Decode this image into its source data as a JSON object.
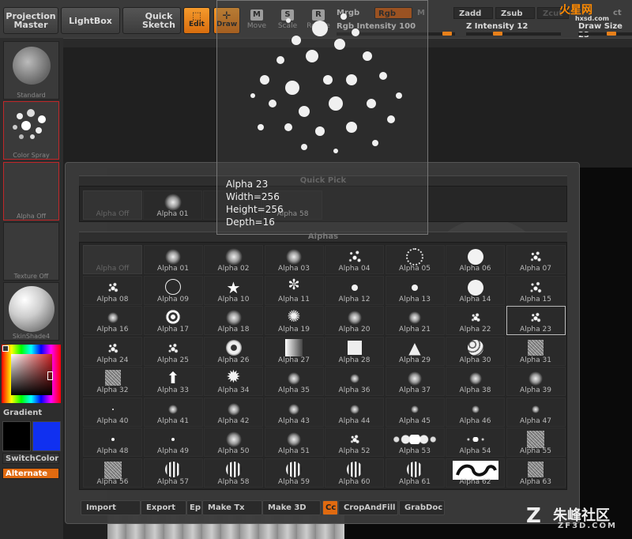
{
  "toolbar": {
    "projection_master": "Projection Master",
    "lightbox": "LightBox",
    "quick_sketch": "Quick Sketch",
    "edit": "Edit",
    "draw": "Draw",
    "move": "Move",
    "scale": "Scale",
    "rotate": "Rotate",
    "mrgb": "Mrgb",
    "rgb": "Rgb",
    "m": "M",
    "zadd": "Zadd",
    "zsub": "Zsub",
    "zcut": "Zcut",
    "rgb_intensity": "Rgb Intensity 100",
    "z_intensity": "Z Intensity 12",
    "draw_size": "Draw Size 23",
    "focal": "ct"
  },
  "left": {
    "standard": "Standard",
    "color_spray": "Color Spray",
    "alpha_off": "Alpha Off",
    "texture_off": "Texture Off",
    "skinshade": "SkinShade4",
    "gradient": "Gradient",
    "switchcolor": "SwitchColor",
    "alternate": "Alternate"
  },
  "tooltip": {
    "name": "Alpha 23",
    "width": "Width=256",
    "height": "Height=256",
    "depth": "Depth=16"
  },
  "quick_pick": {
    "title": "Quick Pick",
    "items": [
      "Alpha Off",
      "Alpha 01",
      "",
      "Alpha 58"
    ]
  },
  "alphas": {
    "title": "Alphas",
    "selected": "Alpha 23",
    "items": [
      "Alpha Off",
      "Alpha 01",
      "Alpha 02",
      "Alpha 03",
      "Alpha 04",
      "Alpha 05",
      "Alpha 06",
      "Alpha 07",
      "Alpha 08",
      "Alpha 09",
      "Alpha 10",
      "Alpha 11",
      "Alpha 12",
      "Alpha 13",
      "Alpha 14",
      "Alpha 15",
      "Alpha 16",
      "Alpha 17",
      "Alpha 18",
      "Alpha 19",
      "Alpha 20",
      "Alpha 21",
      "Alpha 22",
      "Alpha 23",
      "Alpha 24",
      "Alpha 25",
      "Alpha 26",
      "Alpha 27",
      "Alpha 28",
      "Alpha 29",
      "Alpha 30",
      "Alpha 31",
      "Alpha 32",
      "Alpha 33",
      "Alpha 34",
      "Alpha 35",
      "Alpha 36",
      "Alpha 37",
      "Alpha 38",
      "Alpha 39",
      "Alpha 40",
      "Alpha 41",
      "Alpha 42",
      "Alpha 43",
      "Alpha 44",
      "Alpha 45",
      "Alpha 46",
      "Alpha 47",
      "Alpha 48",
      "Alpha 49",
      "Alpha 50",
      "Alpha 51",
      "Alpha 52",
      "Alpha 53",
      "Alpha 54",
      "Alpha 55",
      "Alpha 56",
      "Alpha 57",
      "Alpha 58",
      "Alpha 59",
      "Alpha 60",
      "Alpha 61",
      "Alpha 62",
      "Alpha 63"
    ]
  },
  "bottom": {
    "import": "Import",
    "export": "Export",
    "ep": "Ep",
    "make_tx": "Make Tx",
    "make_3d": "Make 3D",
    "cc": "Cc",
    "cropandfill": "CropAndFill",
    "grabdoc": "GrabDoc"
  },
  "watermarks": {
    "top": "火星网",
    "top_url": "hxsd.com",
    "bottom": "朱峰社区",
    "bottom_url": "ZF3D.COM"
  },
  "colors": {
    "accent": "#e8801a",
    "selection": "#c0282a",
    "secondary_color": "#1030f0"
  }
}
